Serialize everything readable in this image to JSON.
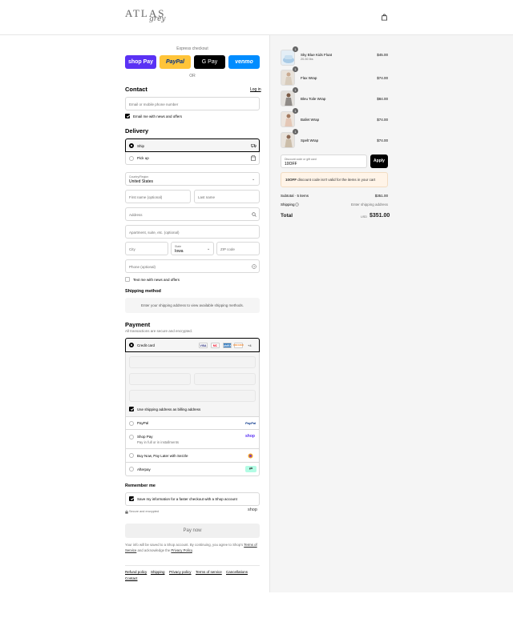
{
  "header": {
    "logo": "ATLAS",
    "logo_script": "grey"
  },
  "express": {
    "label": "Express checkout",
    "buttons": [
      {
        "label": "shop Pay",
        "bg": "#5a31f4",
        "fg": "#ffffff"
      },
      {
        "label": "PayPal",
        "bg": "#ffc439",
        "fg": "#003087"
      },
      {
        "label": "G Pay",
        "bg": "#000000",
        "fg": "#ffffff"
      },
      {
        "label": "venmo",
        "bg": "#008cff",
        "fg": "#ffffff"
      }
    ],
    "or": "OR"
  },
  "contact": {
    "title": "Contact",
    "login": "Log in",
    "email_placeholder": "Email or mobile phone number",
    "news_label": "Email me with news and offers"
  },
  "delivery": {
    "title": "Delivery",
    "ship_label": "Ship",
    "pickup_label": "Pick up",
    "country_label": "Country/Region",
    "country_value": "United States",
    "first_name": "First name (optional)",
    "last_name": "Last name",
    "address": "Address",
    "apartment": "Apartment, suite, etc. (optional)",
    "city": "City",
    "state_label": "State",
    "state_value": "Iowa",
    "zip": "ZIP code",
    "phone": "Phone (optional)",
    "text_news": "Text me with news and offers"
  },
  "shipping_method": {
    "title": "Shipping method",
    "message": "Enter your shipping address to view available shipping methods."
  },
  "payment": {
    "title": "Payment",
    "subtitle": "All transactions are secure and encrypted.",
    "credit_card": "Credit card",
    "brands": [
      {
        "label": "VISA",
        "fg": "#1a1f71",
        "bg": "#ffffff"
      },
      {
        "label": "MC",
        "fg": "#eb001b",
        "bg": "#ffffff"
      },
      {
        "label": "AMEX",
        "fg": "#ffffff",
        "bg": "#2e77bc"
      },
      {
        "label": "DISCOVER",
        "fg": "#f48120",
        "bg": "#ffffff"
      }
    ],
    "more": "+4",
    "billing_same": "Use shipping address as billing address",
    "paypal": "PayPal",
    "paypal_logo": "PayPal",
    "shoppay": "Shop Pay",
    "shoppay_sub": "Pay in full or in installments",
    "shoppay_logo": "shop",
    "sezzle": "Buy Now, Pay Later with Sezzle",
    "afterpay": "Afterpay"
  },
  "remember": {
    "title": "Remember me",
    "save_label": "Save my information for a faster checkout with a Shop account",
    "secure": "Secure and encrypted",
    "shop_logo": "shop"
  },
  "pay_now": "Pay now",
  "legal": {
    "prefix": "Your info will be saved to a Shop account. By continuing, you agree to Shop's",
    "terms": "Terms of Service",
    "and": " and acknowledge the ",
    "privacy": "Privacy Policy",
    "suffix": "."
  },
  "footer_links": [
    "Refund policy",
    "Shipping",
    "Privacy policy",
    "Terms of service",
    "Cancellations",
    "Contact"
  ],
  "cart": {
    "items": [
      {
        "name": "Sky Blue Kids Float",
        "sub": "20-50 lbs",
        "price": "$45.00",
        "qty": "1"
      },
      {
        "name": "Flax Wrap",
        "sub": "",
        "price": "$74.00",
        "qty": "1"
      },
      {
        "name": "Bleu Toile Wrap",
        "sub": "",
        "price": "$84.00",
        "qty": "1"
      },
      {
        "name": "Ballet Wrap",
        "sub": "",
        "price": "$74.00",
        "qty": "1"
      },
      {
        "name": "Spelt Wrap",
        "sub": "",
        "price": "$74.00",
        "qty": "1"
      }
    ],
    "discount_label": "Discount code or gift card",
    "discount_value": "10OFF",
    "apply": "Apply",
    "discount_error_code": "10OFF",
    "discount_error_text": " discount code isn't valid for the items in your cart",
    "subtotal_label": "Subtotal · 5 items",
    "subtotal_value": "$351.00",
    "shipping_label": "Shipping",
    "shipping_value": "Enter shipping address",
    "total_label": "Total",
    "currency": "USD",
    "total_value": "$351.00"
  }
}
